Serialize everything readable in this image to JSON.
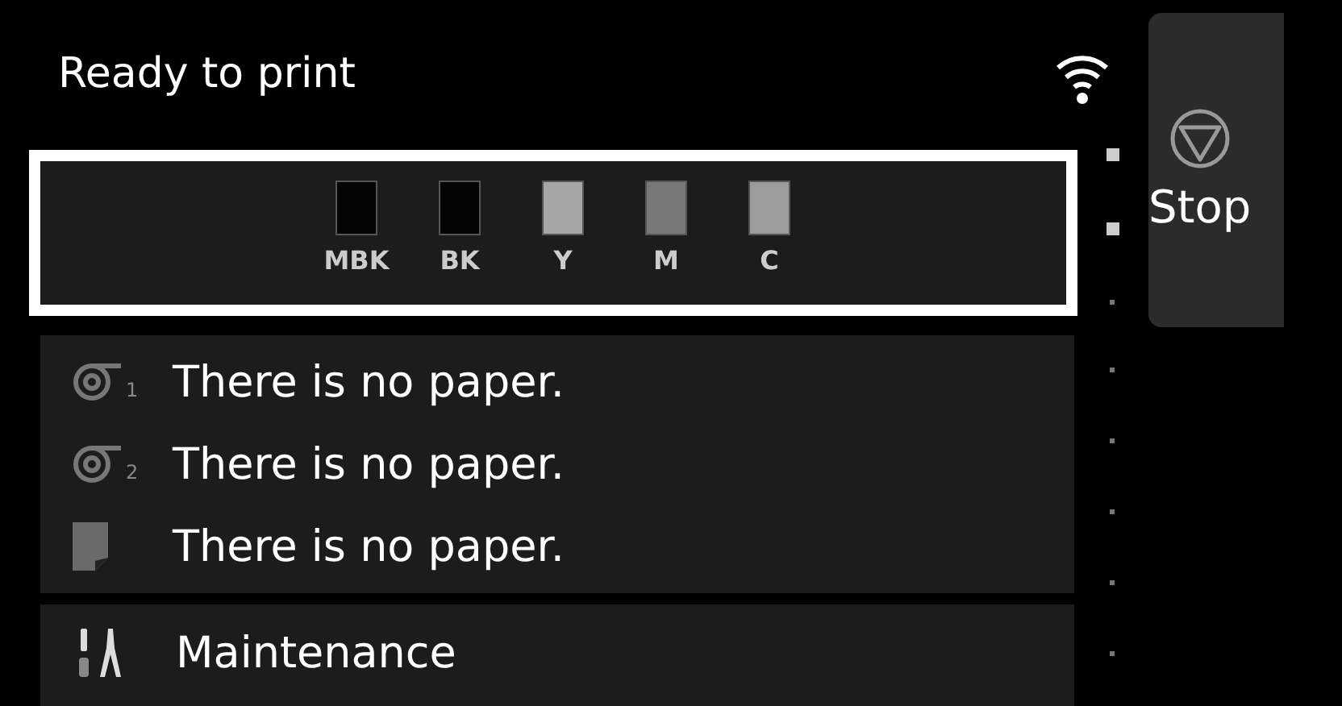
{
  "status": {
    "title": "Ready to print"
  },
  "inks": [
    {
      "label": "MBK",
      "color": "#050505"
    },
    {
      "label": "BK",
      "color": "#050505"
    },
    {
      "label": "Y",
      "color": "#a6a6a6"
    },
    {
      "label": "M",
      "color": "#787878"
    },
    {
      "label": "C",
      "color": "#9c9c9c"
    }
  ],
  "paper_sources": [
    {
      "kind": "roll",
      "badge": "1",
      "message": "There is no paper."
    },
    {
      "kind": "roll",
      "badge": "2",
      "message": "There is no paper."
    },
    {
      "kind": "sheet",
      "message": "There is no paper."
    }
  ],
  "menu": [
    {
      "kind": "maintenance",
      "label": "Maintenance"
    }
  ],
  "stop_button": {
    "label": "Stop"
  }
}
